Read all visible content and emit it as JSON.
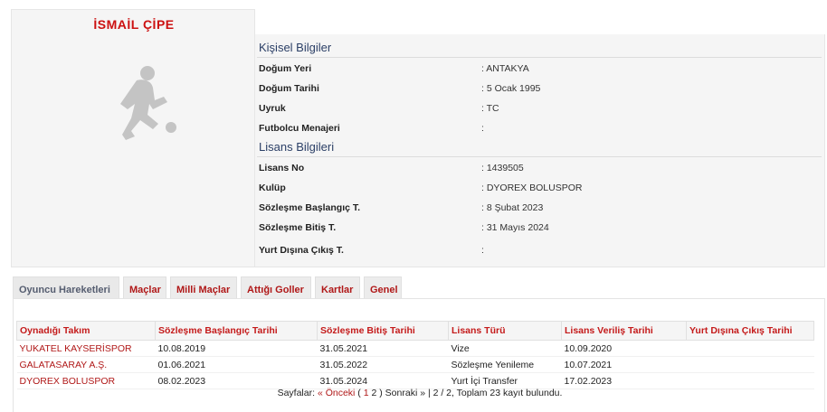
{
  "player": {
    "name": "İSMAİL ÇİPE"
  },
  "personal": {
    "title": "Kişisel Bilgiler",
    "rows": [
      {
        "label": "Doğum Yeri",
        "value": ":  ANTAKYA"
      },
      {
        "label": "Doğum Tarihi",
        "value": ":  5 Ocak 1995"
      },
      {
        "label": "Uyruk",
        "value": ":  TC"
      },
      {
        "label": "Futbolcu Menajeri",
        "value": ":"
      }
    ]
  },
  "license": {
    "title": "Lisans Bilgileri",
    "rows": [
      {
        "label": "Lisans No",
        "value": ": 1439505"
      },
      {
        "label": "Kulüp",
        "value": ": DYOREX BOLUSPOR"
      },
      {
        "label": "Sözleşme Başlangıç T.",
        "value": ": 8 Şubat 2023"
      },
      {
        "label": "Sözleşme Bitiş T.",
        "value": ": 31 Mayıs 2024"
      },
      {
        "label": "Yurt Dışına Çıkış T.",
        "value": ":"
      }
    ]
  },
  "tabs": [
    {
      "label": "Oyuncu Hareketleri",
      "active": true
    },
    {
      "label": "Maçlar"
    },
    {
      "label": "Milli Maçlar"
    },
    {
      "label": "Attığı Goller"
    },
    {
      "label": "Kartlar"
    },
    {
      "label": "Genel"
    }
  ],
  "table": {
    "headers": [
      "Oynadığı Takım",
      "Sözleşme Başlangıç Tarihi",
      "Sözleşme Bitiş Tarihi",
      "Lisans Türü",
      "Lisans Veriliş Tarihi",
      "Yurt Dışına Çıkış Tarihi"
    ],
    "rows": [
      [
        "YUKATEL KAYSERİSPOR",
        "10.08.2019",
        "31.05.2021",
        "Vize",
        "10.09.2020",
        ""
      ],
      [
        "GALATASARAY A.Ş.",
        "01.06.2021",
        "31.05.2022",
        "Sözleşme Yenileme",
        "10.07.2021",
        ""
      ],
      [
        "DYOREX BOLUSPOR",
        "08.02.2023",
        "31.05.2024",
        "Yurt İçi Transfer",
        "17.02.2023",
        ""
      ]
    ]
  },
  "pager": {
    "prefix": "Sayfalar: ",
    "prev": "« Önceki",
    "open": " ( ",
    "page1": "1",
    "sep": " ",
    "page2": "2",
    "close": " ) ",
    "next": "Sonraki »",
    "summary": " | 2 / 2, Toplam 23 kayıt bulundu."
  },
  "colors": {
    "accent": "#b01818",
    "section_title": "#2b3f66"
  },
  "icons": {
    "photo": "player-silhouette-icon"
  }
}
